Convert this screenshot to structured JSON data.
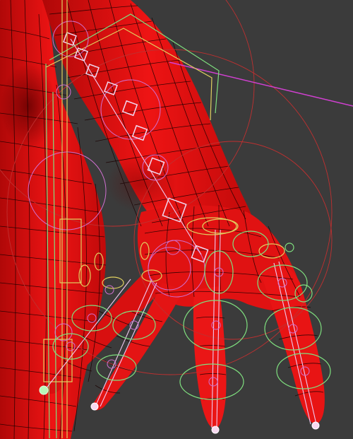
{
  "viewport": {
    "background": "#3b3b3b",
    "mesh_color": "#e01010",
    "wire_color": "#1a0000",
    "control_colors": {
      "green": "#7fe07f",
      "yellow": "#e0d060",
      "pink": "#d070d0",
      "red": "#c03030",
      "magenta_line": "#d040d0",
      "bone": "#f0c8f0"
    }
  }
}
